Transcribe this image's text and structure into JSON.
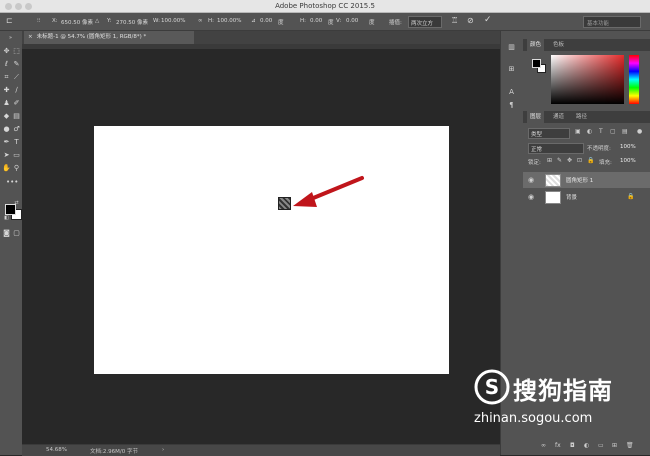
{
  "app": {
    "window_title": "Adobe Photoshop CC 2015.5"
  },
  "options_bar": {
    "x_label": "X:",
    "x_value": "650.50 像素",
    "y_label": "Y:",
    "y_value": "270.50 像素",
    "w_label": "W:",
    "w_value": "100.00%",
    "h_label": "H:",
    "h_value": "100.00%",
    "angle_value": "0.00",
    "angle_unit": "度",
    "hskew_label": "H:",
    "hskew_value": "0.00",
    "hskew_unit": "度",
    "vskew_label": "V:",
    "vskew_value": "0.00",
    "vskew_unit": "度",
    "interp_label": "插值:",
    "interp_value": "两次立方",
    "workspace": "基本功能"
  },
  "document": {
    "tab_title": "未标题-1 @ 54.7% (圆角矩形 1, RGB/8*) *"
  },
  "status": {
    "zoom": "54.68%",
    "doc_info": "文档:2.96M/0 字节"
  },
  "color_panel": {
    "tabs": [
      "颜色",
      "色板"
    ],
    "accent": "#e52b2b"
  },
  "layers_panel": {
    "tabs": [
      "图层",
      "通道",
      "路径"
    ],
    "filter_kind": "类型",
    "blend_mode": "正常",
    "opacity_label": "不透明度:",
    "opacity_value": "100%",
    "lock_label": "锁定:",
    "fill_label": "填充:",
    "fill_value": "100%",
    "layers": [
      {
        "name": "圆角矩形 1",
        "selected": true
      },
      {
        "name": "背景",
        "selected": false
      }
    ],
    "footer_icons": [
      "link-icon",
      "fx-icon",
      "mask-icon",
      "adjustment-icon",
      "folder-icon",
      "new-layer-icon",
      "trash-icon"
    ]
  },
  "watermark": {
    "brand": "搜狗指南",
    "url": "zhinan.sogou.com"
  }
}
